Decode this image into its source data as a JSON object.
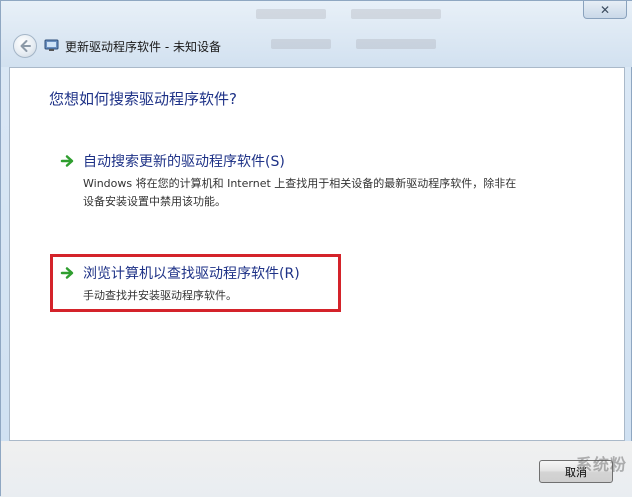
{
  "window": {
    "title": "更新驱动程序软件 - 未知设备",
    "close_label": "✕"
  },
  "content": {
    "question": "您想如何搜索驱动程序软件?",
    "options": [
      {
        "title": "自动搜索更新的驱动程序软件(S)",
        "description": "Windows 将在您的计算机和 Internet 上查找用于相关设备的最新驱动程序软件，除非在设备安装设置中禁用该功能。"
      },
      {
        "title": "浏览计算机以查找驱动程序软件(R)",
        "description": "手动查找并安装驱动程序软件。"
      }
    ]
  },
  "footer": {
    "cancel_label": "取消",
    "watermark": "系统粉"
  },
  "colors": {
    "link_blue": "#1e3287",
    "arrow_green": "#2f9e2f",
    "highlight_red": "#d4232a"
  },
  "icons": {
    "back": "back-arrow-icon",
    "option": "green-arrow-icon",
    "close": "close-icon"
  }
}
